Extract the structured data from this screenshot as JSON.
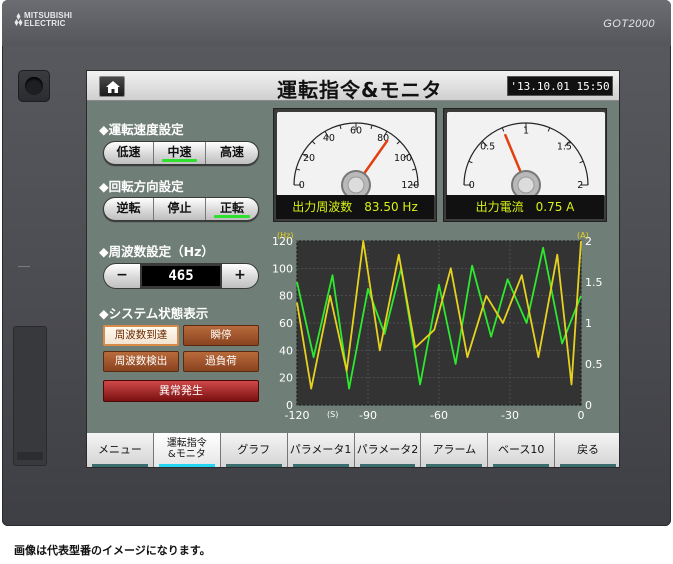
{
  "device": {
    "brand_line1": "MITSUBISHI",
    "brand_line2": "ELECTRIC",
    "model": "GOT2000"
  },
  "screen": {
    "title": "運転指令&モニタ",
    "clock": "'13.10.01 15:50",
    "speed": {
      "label": "◆運転速度設定",
      "buttons": [
        "低速",
        "中速",
        "高速"
      ],
      "selected": "中速"
    },
    "direction": {
      "label": "◆回転方向設定",
      "buttons": [
        "逆転",
        "停止",
        "正転"
      ],
      "selected": "正転"
    },
    "frequency": {
      "label": "◆周波数設定（Hz）",
      "minus": "−",
      "plus": "+",
      "value": "465"
    },
    "status": {
      "label": "◆システム状態表示",
      "lamps": [
        {
          "text": "周波数到達",
          "lit": true
        },
        {
          "text": "瞬停",
          "lit": false
        },
        {
          "text": "周波数検出",
          "lit": false
        },
        {
          "text": "過負荷",
          "lit": false
        }
      ],
      "alarm": "異常発生"
    },
    "gauge_freq": {
      "ticks": [
        "0",
        "20",
        "40",
        "60",
        "80",
        "100",
        "120"
      ],
      "min": 0,
      "max": 120,
      "value": 83.5,
      "readout": "出力周波数　83.50 Hz"
    },
    "gauge_current": {
      "ticks": [
        "0",
        "0.5",
        "1",
        "1.5",
        "2"
      ],
      "min": 0,
      "max": 2,
      "value": 0.75,
      "readout": "出力電流　0.75 A"
    },
    "nav": [
      {
        "label": "メニュー",
        "active": false
      },
      {
        "label": "運転指令\n&モニタ",
        "active": true
      },
      {
        "label": "グラフ",
        "active": false
      },
      {
        "label": "パラメータ1",
        "active": false
      },
      {
        "label": "パラメータ2",
        "active": false
      },
      {
        "label": "アラーム",
        "active": false
      },
      {
        "label": "ベース10",
        "active": false
      },
      {
        "label": "戻る",
        "active": false
      }
    ]
  },
  "colors": {
    "freq_series": "#2ee82e",
    "current_series": "#e6d21e",
    "plot_bg": "#333333"
  },
  "chart_data": {
    "type": "line",
    "left_unit": "(Hz)",
    "right_unit": "(A)",
    "x_unit": "(S)",
    "xlim": [
      -120,
      0
    ],
    "ylim_left": [
      0,
      120
    ],
    "ylim_right": [
      0,
      2
    ],
    "x_ticks": [
      "-120",
      "-90",
      "-60",
      "-30",
      "0"
    ],
    "y_left_ticks": [
      "0",
      "20",
      "40",
      "60",
      "80",
      "100",
      "120"
    ],
    "y_right_ticks": [
      "0",
      "0.5",
      "1",
      "1.5",
      "2"
    ],
    "series": [
      {
        "axis": "left",
        "x": [
          -120,
          -113,
          -105,
          -98,
          -90,
          -83,
          -76,
          -68,
          -60,
          -53,
          -46,
          -38,
          -31,
          -23,
          -16,
          -8,
          0
        ],
        "values": [
          90,
          35,
          95,
          12,
          85,
          52,
          100,
          15,
          88,
          30,
          102,
          50,
          92,
          60,
          115,
          45,
          80
        ]
      },
      {
        "axis": "left",
        "x": [
          -120,
          -114,
          -106,
          -99,
          -92,
          -85,
          -77,
          -70,
          -62,
          -55,
          -48,
          -40,
          -33,
          -25,
          -18,
          -10,
          -4,
          0
        ],
        "values": [
          75,
          12,
          80,
          25,
          120,
          40,
          110,
          42,
          55,
          100,
          35,
          80,
          60,
          95,
          35,
          110,
          15,
          120
        ]
      }
    ]
  },
  "caption": "画像は代表型番のイメージになります。"
}
